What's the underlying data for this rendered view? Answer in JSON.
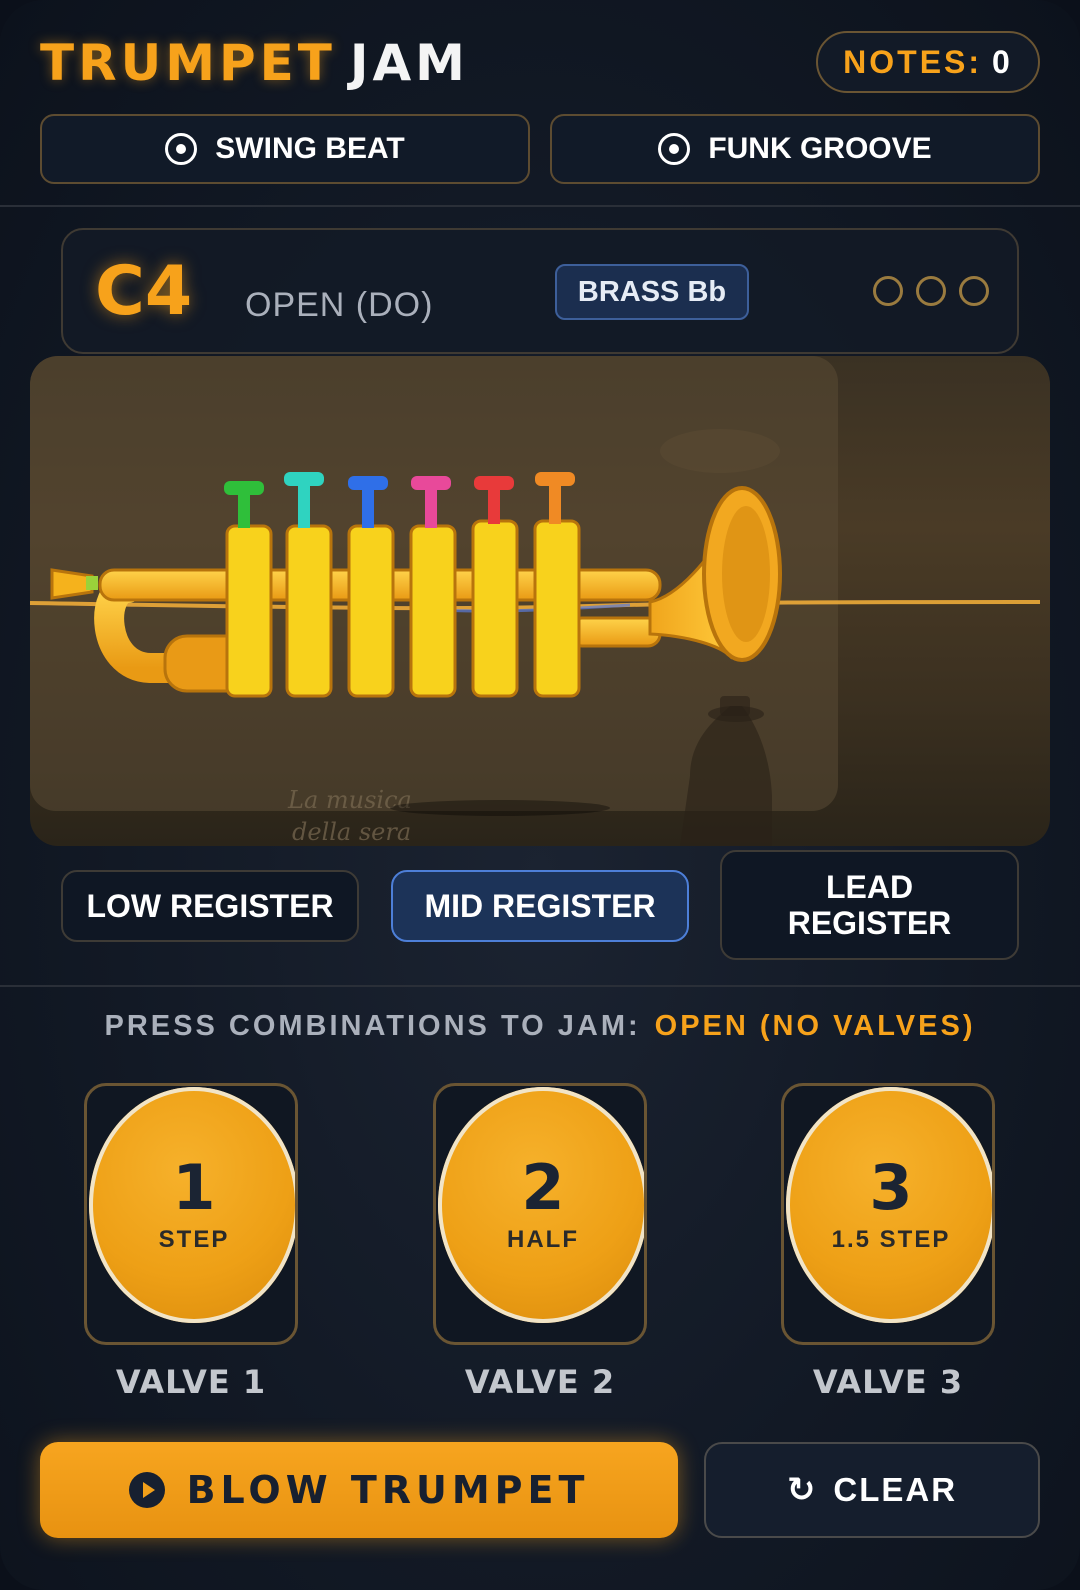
{
  "header": {
    "title_part1": "TRUMPET",
    "title_part2": "JAM",
    "notes_label": "NOTES:",
    "notes_count": "0"
  },
  "beats": [
    {
      "label": "SWING BEAT",
      "icon": "radio-icon"
    },
    {
      "label": "FUNK GROOVE",
      "icon": "radio-icon"
    }
  ],
  "note_panel": {
    "note": "C4",
    "description": "OPEN (DO)",
    "instrument": "BRASS Bb",
    "valve_indicators": [
      false,
      false,
      false
    ]
  },
  "stage": {
    "sign_line1": "La musica",
    "sign_line2": "della sera",
    "valve_cap_colors": [
      "#2fbf3a",
      "#2fd3c0",
      "#2f6fe8",
      "#e8499a",
      "#e83a3a",
      "#f08a24"
    ],
    "brass_color": "#f5b21c"
  },
  "registers": [
    {
      "label": "LOW REGISTER",
      "active": false
    },
    {
      "label": "MID REGISTER",
      "active": true
    },
    {
      "label": "LEAD REGISTER",
      "active": false
    }
  ],
  "hint": {
    "label": "PRESS COMBINATIONS TO JAM:",
    "value": "OPEN (NO VALVES)"
  },
  "valves": [
    {
      "number": "1",
      "sub": "STEP",
      "label": "VALVE 1"
    },
    {
      "number": "2",
      "sub": "HALF",
      "label": "VALVE 2"
    },
    {
      "number": "3",
      "sub": "1.5 STEP",
      "label": "VALVE 3"
    }
  ],
  "actions": {
    "blow_label": "BLOW TRUMPET",
    "blow_icon": "play-icon",
    "clear_label": "CLEAR",
    "clear_icon": "refresh-icon"
  },
  "colors": {
    "accent": "#f7a21b",
    "active_blue": "#4d7fd8",
    "background": "#121925"
  }
}
